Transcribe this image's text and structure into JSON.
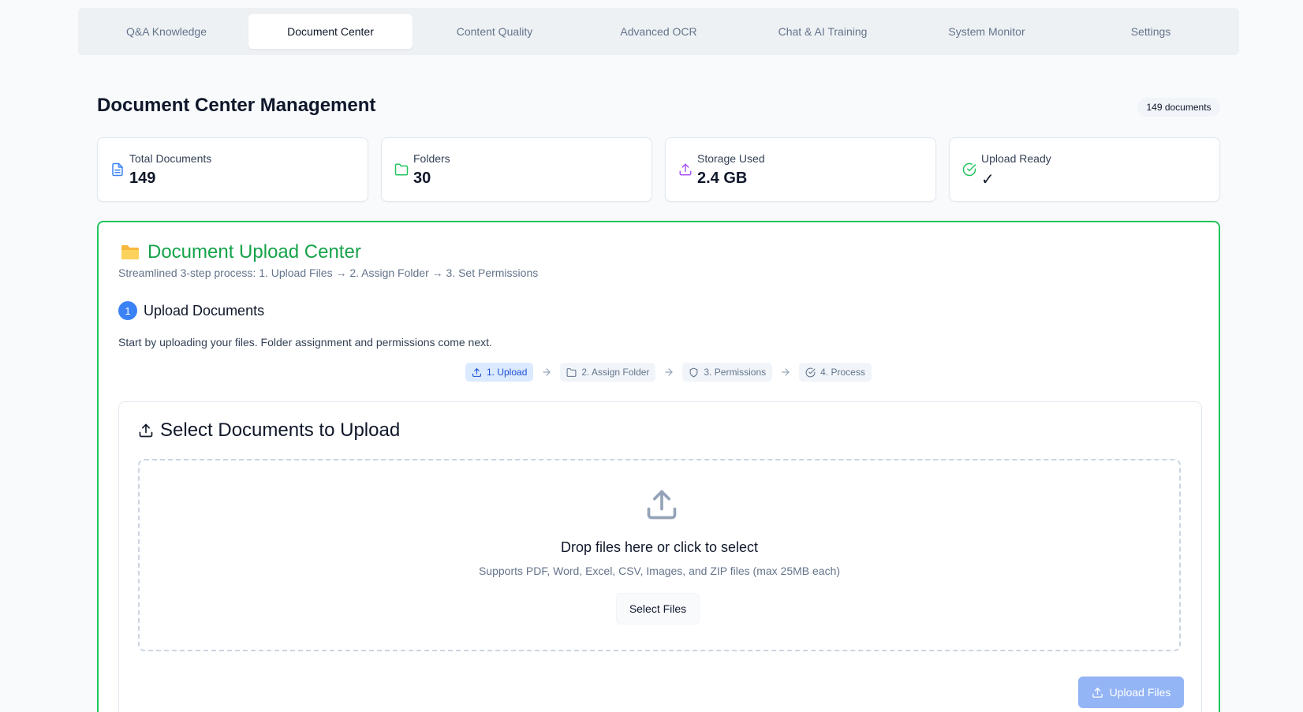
{
  "tabs": [
    {
      "label": "Q&A Knowledge"
    },
    {
      "label": "Document Center",
      "active": true
    },
    {
      "label": "Content Quality"
    },
    {
      "label": "Advanced OCR"
    },
    {
      "label": "Chat & AI Training"
    },
    {
      "label": "System Monitor"
    },
    {
      "label": "Settings"
    }
  ],
  "header": {
    "title": "Document Center Management",
    "doc_count_badge": "149 documents"
  },
  "stats": [
    {
      "label": "Total Documents",
      "value": "149",
      "icon": "file-text-icon",
      "color": "#3b82f6"
    },
    {
      "label": "Folders",
      "value": "30",
      "icon": "folder-icon",
      "color": "#22c55e"
    },
    {
      "label": "Storage Used",
      "value": "2.4 GB",
      "icon": "upload-icon",
      "color": "#a855f7"
    },
    {
      "label": "Upload Ready",
      "value": "✓",
      "icon": "check-circle-icon",
      "color": "#22c55e"
    }
  ],
  "upload_center": {
    "title": "Document Upload Center",
    "subtitle": "Streamlined 3-step process: 1. Upload Files → 2. Assign Folder → 3. Set Permissions",
    "step_number": "1",
    "step_title": "Upload Documents",
    "step_description": "Start by uploading your files. Folder assignment and permissions come next.",
    "pipeline": [
      {
        "label": "1. Upload",
        "icon": "upload-icon",
        "active": true
      },
      {
        "label": "2. Assign Folder",
        "icon": "folder-icon"
      },
      {
        "label": "3. Permissions",
        "icon": "shield-icon"
      },
      {
        "label": "4. Process",
        "icon": "check-circle-icon"
      }
    ],
    "select_card": {
      "title": "Select Documents to Upload",
      "drop_title": "Drop files here or click to select",
      "drop_subtitle": "Supports PDF, Word, Excel, CSV, Images, and ZIP files (max 25MB each)",
      "select_button": "Select Files",
      "upload_button": "Upload Files"
    }
  },
  "colors": {
    "accent_green": "#16a34a",
    "accent_blue": "#3b82f6",
    "upload_button_disabled": "#93b4f5"
  }
}
